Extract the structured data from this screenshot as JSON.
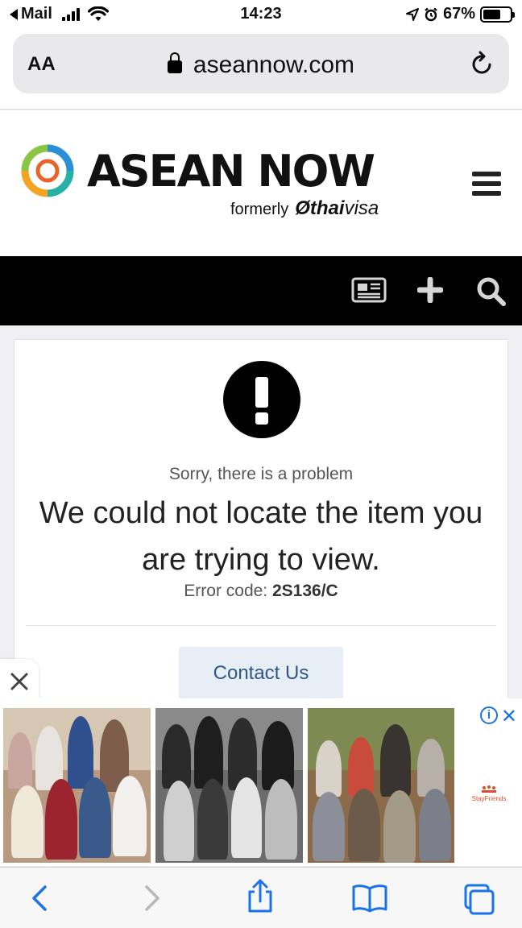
{
  "status_bar": {
    "back_app": "Mail",
    "time": "14:23",
    "battery_percent": "67%",
    "battery_level": 0.67
  },
  "url_bar": {
    "text_size_label": "AA",
    "domain": "aseannow.com"
  },
  "site": {
    "brand": "ASEAN NOW",
    "formerly_label": "formerly",
    "former_brand_bold": "thai",
    "former_brand_light": "visa"
  },
  "error": {
    "sorry": "Sorry, there is a problem",
    "headline": "We could not locate the item you are trying to view.",
    "code_label": "Error code:",
    "code": "2S136/C",
    "contact_label": "Contact Us"
  },
  "ad": {
    "advertiser": "StayFriends"
  },
  "colors": {
    "nav_bg": "#000000",
    "link_blue": "#2e5686",
    "ios_blue": "#1a73e8"
  }
}
